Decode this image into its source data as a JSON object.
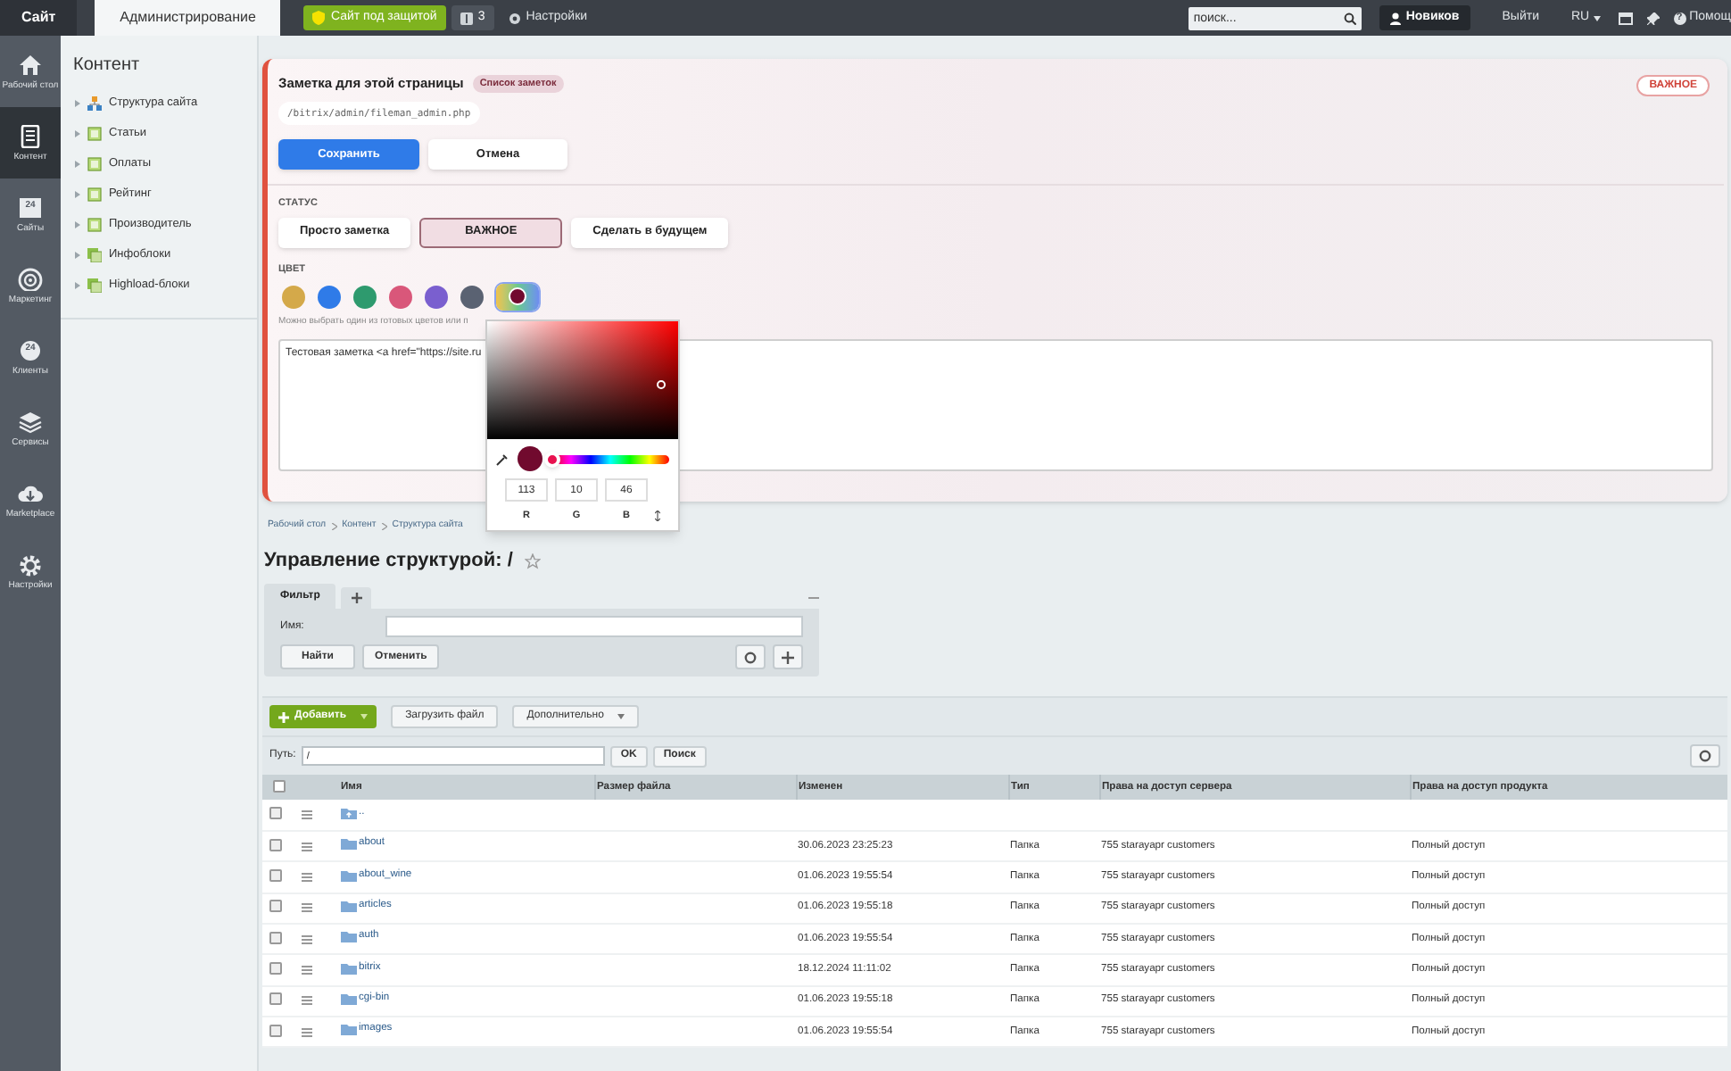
{
  "top_bar": {
    "tabs": [
      {
        "label": "Сайт",
        "selected": false
      },
      {
        "label": "Администрирование",
        "selected": true
      }
    ],
    "protect_button": "Сайт под защитой",
    "notifications_count": "3",
    "settings": "Настройки",
    "search": {
      "placeholder": "поиск..."
    },
    "user": "Новиков",
    "logout": "Выйти",
    "language": "RU",
    "help_icon": "?",
    "help": "Помощ"
  },
  "sidebar": {
    "items": [
      {
        "label": "Рабочий стол",
        "selected": false
      },
      {
        "label": "Контент",
        "selected": true
      },
      {
        "label": "Сайты",
        "selected": false,
        "icon_text": "24"
      },
      {
        "label": "Маркетинг",
        "selected": false
      },
      {
        "label": "Клиенты",
        "selected": false,
        "icon_text": "24"
      },
      {
        "label": "Сервисы",
        "selected": false
      },
      {
        "label": "Marketplace",
        "selected": false
      },
      {
        "label": "Настройки",
        "selected": false
      }
    ]
  },
  "tree": {
    "title": "Контент",
    "items": [
      {
        "label": "Структура сайта",
        "kind": "structure"
      },
      {
        "label": "Статьи",
        "kind": "iblock"
      },
      {
        "label": "Оплаты",
        "kind": "iblock"
      },
      {
        "label": "Рейтинг",
        "kind": "iblock"
      },
      {
        "label": "Производитель",
        "kind": "iblock"
      },
      {
        "label": "Инфоблоки",
        "kind": "group"
      },
      {
        "label": "Highload-блоки",
        "kind": "group"
      }
    ]
  },
  "note": {
    "title": "Заметка для этой страницы",
    "list_button": "Список заметок",
    "url": "/bitrix/admin/fileman_admin.php",
    "badge": "ВАЖНОЕ",
    "save": "Сохранить",
    "cancel": "Отмена",
    "status_label": "СТАТУС",
    "statuses": [
      {
        "label": "Просто заметка",
        "selected": false
      },
      {
        "label": "ВАЖНОЕ",
        "selected": true
      },
      {
        "label": "Сделать в будущем",
        "selected": false
      }
    ],
    "color_label": "ЦВЕТ",
    "colors": [
      {
        "color": "#d4a94a",
        "selected": false,
        "kind": "preset"
      },
      {
        "color": "#2f7be8",
        "selected": false,
        "kind": "preset"
      },
      {
        "color": "#2e9a6e",
        "selected": false,
        "kind": "preset"
      },
      {
        "color": "#d9577a",
        "selected": false,
        "kind": "preset"
      },
      {
        "color": "#7a5fcf",
        "selected": false,
        "kind": "preset"
      },
      {
        "color": "#5a6272",
        "selected": false,
        "kind": "preset"
      },
      {
        "color": "#710a2e",
        "selected": true,
        "kind": "custom"
      }
    ],
    "hint": "Можно выбрать один из готовых цветов или п",
    "text": "Тестовая заметка <a href=\"https://site.ru"
  },
  "color_picker": {
    "hue": {
      "level": 0.0
    },
    "channels": [
      {
        "label": "R",
        "value": "113"
      },
      {
        "label": "G",
        "value": "10"
      },
      {
        "label": "B",
        "value": "46"
      }
    ]
  },
  "breadcrumbs": [
    "Рабочий стол",
    "Контент",
    "Структура сайта"
  ],
  "page_title": "Управление структурой: /",
  "filter": {
    "tab": "Фильтр",
    "field_label": "Имя:",
    "find": "Найти",
    "cancel": "Отменить"
  },
  "toolbar": {
    "add": "Добавить",
    "upload": "Загрузить файл",
    "more": "Дополнительно",
    "path_label": "Путь:",
    "path": "/",
    "ok": "OK",
    "search": "Поиск"
  },
  "table": {
    "select_all_checked": false,
    "columns": [
      "Имя",
      "Размер файла",
      "Изменен",
      "Тип",
      "Права на доступ сервера",
      "Права на доступ продукта"
    ],
    "rows": [
      {
        "kind": "parent",
        "checked": false,
        "cells": [
          "..",
          "",
          "",
          "",
          "",
          ""
        ]
      },
      {
        "kind": "folder",
        "checked": false,
        "cells": [
          "about",
          "",
          "30.06.2023 23:25:23",
          "Папка",
          "755 starayapr customers",
          "Полный доступ"
        ]
      },
      {
        "kind": "folder",
        "checked": false,
        "cells": [
          "about_wine",
          "",
          "01.06.2023 19:55:54",
          "Папка",
          "755 starayapr customers",
          "Полный доступ"
        ]
      },
      {
        "kind": "folder",
        "checked": false,
        "cells": [
          "articles",
          "",
          "01.06.2023 19:55:18",
          "Папка",
          "755 starayapr customers",
          "Полный доступ"
        ]
      },
      {
        "kind": "folder",
        "checked": false,
        "cells": [
          "auth",
          "",
          "01.06.2023 19:55:54",
          "Папка",
          "755 starayapr customers",
          "Полный доступ"
        ]
      },
      {
        "kind": "folder",
        "checked": false,
        "cells": [
          "bitrix",
          "",
          "18.12.2024 11:11:02",
          "Папка",
          "755 starayapr customers",
          "Полный доступ"
        ]
      },
      {
        "kind": "folder",
        "checked": false,
        "cells": [
          "cgi-bin",
          "",
          "01.06.2023 19:55:18",
          "Папка",
          "755 starayapr customers",
          "Полный доступ"
        ]
      },
      {
        "kind": "folder",
        "checked": false,
        "cells": [
          "images",
          "",
          "01.06.2023 19:55:54",
          "Папка",
          "755 starayapr customers",
          "Полный доступ"
        ]
      }
    ]
  }
}
